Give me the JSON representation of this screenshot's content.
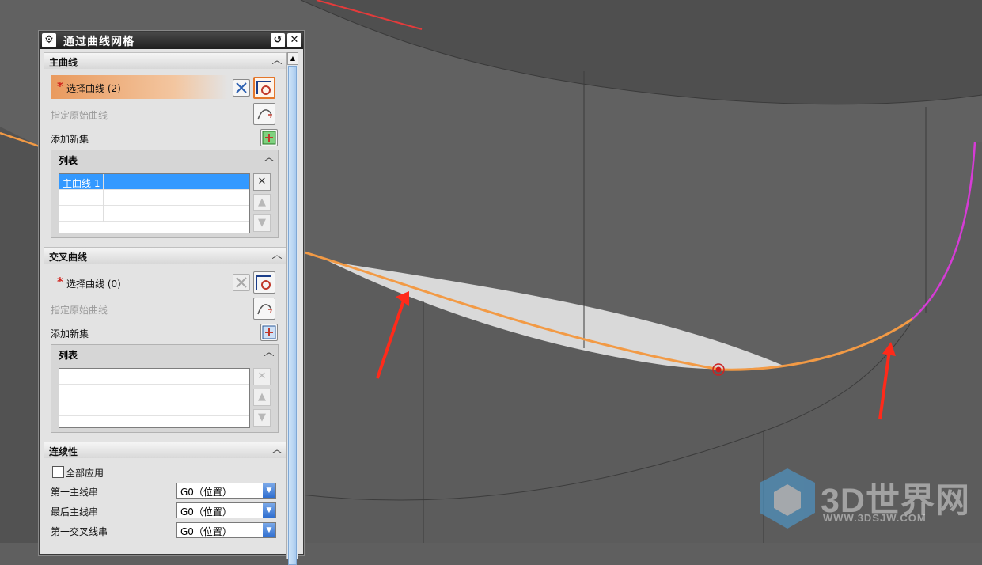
{
  "dialog": {
    "title": "通过曲线网格",
    "main_curves": {
      "header": "主曲线",
      "select_label": "选择曲线 (2)",
      "specify_original": "指定原始曲线",
      "add_new_set": "添加新集",
      "list_header": "列表",
      "list_items": [
        "主曲线 1"
      ]
    },
    "cross_curves": {
      "header": "交叉曲线",
      "select_label": "选择曲线 (0)",
      "specify_original": "指定原始曲线",
      "add_new_set": "添加新集",
      "list_header": "列表",
      "list_items": []
    },
    "continuity": {
      "header": "连续性",
      "apply_all": "全部应用",
      "rows": [
        {
          "label": "第一主线串",
          "value": "G0（位置）"
        },
        {
          "label": "最后主线串",
          "value": "G0（位置）"
        },
        {
          "label": "第一交叉线串",
          "value": "G0（位置）"
        }
      ]
    }
  },
  "watermark": {
    "text": "3D世界网",
    "url": "WWW.3DSJW.COM"
  },
  "colors": {
    "curve_orange": "#f29a45",
    "curve_magenta": "#d63bd6",
    "arrow_red": "#ff2a1a",
    "selection_blue": "#3399ff"
  }
}
